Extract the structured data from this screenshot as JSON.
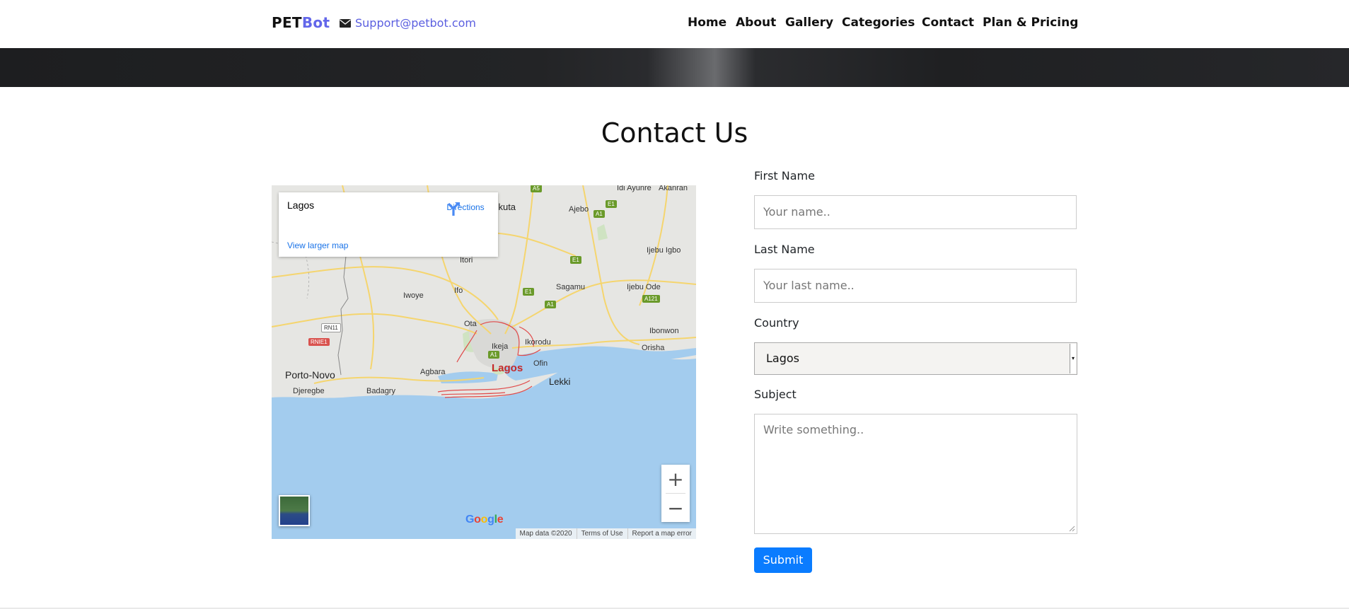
{
  "navbar": {
    "brand_part1": "PET",
    "brand_part2": "Bot",
    "email": "Support@petbot.com",
    "links": [
      "Home",
      "About",
      "Gallery",
      "Categories",
      "Contact",
      "Plan & Pricing"
    ]
  },
  "page": {
    "title": "Contact Us"
  },
  "map": {
    "place_name": "Lagos",
    "directions_label": "Directions",
    "view_larger": "View larger map",
    "zoom_in": "+",
    "zoom_out": "−",
    "google": [
      "G",
      "o",
      "o",
      "g",
      "l",
      "e"
    ],
    "google_colors": [
      "#4285F4",
      "#EA4335",
      "#FBBC05",
      "#4285F4",
      "#34A853",
      "#EA4335"
    ],
    "attribution": [
      "Map data ©2020",
      "Terms of Use",
      "Report a map error"
    ],
    "labels": {
      "idi_ayunre": "Idi Ayunre",
      "akanran": "Akanran",
      "abeokuta": "eokuta",
      "ajebo": "Ajebo",
      "ijebu_igbo": "Ijebu Igbo",
      "itori": "Itori",
      "ifo": "Ifo",
      "sagamu": "Sagamu",
      "ijebu_ode": "Ijebu Ode",
      "iwoye": "Iwoye",
      "ota": "Ota",
      "ikorodu": "Ikorodu",
      "ikeja": "Ikeja",
      "ibonwon": "Ibonwon",
      "orisha": "Orisha",
      "porto_novo": "Porto-Novo",
      "agbara": "Agbara",
      "lagos": "Lagos",
      "ofin": "Ofin",
      "lekki": "Lekki",
      "djeregbe": "Djeregbe",
      "badagry": "Badagry"
    },
    "road_badges": {
      "a5": "A5",
      "e1_a": "E1",
      "a1_a": "A1",
      "e1_b": "E1",
      "e1_c": "E1",
      "a1_b": "A1",
      "a121": "A121",
      "a1_c": "A1",
      "rn11": "RN11",
      "rnie1": "RNIE1"
    }
  },
  "form": {
    "first_name_label": "First Name",
    "first_name_placeholder": "Your name..",
    "last_name_label": "Last Name",
    "last_name_placeholder": "Your last name..",
    "country_label": "Country",
    "country_value": "Lagos",
    "subject_label": "Subject",
    "subject_placeholder": "Write something..",
    "submit_label": "Submit"
  },
  "colors": {
    "brand_accent": "#6266ea",
    "submit_blue": "#0a7cff",
    "link_blue": "#1a73e8",
    "water": "#a3ccee"
  }
}
